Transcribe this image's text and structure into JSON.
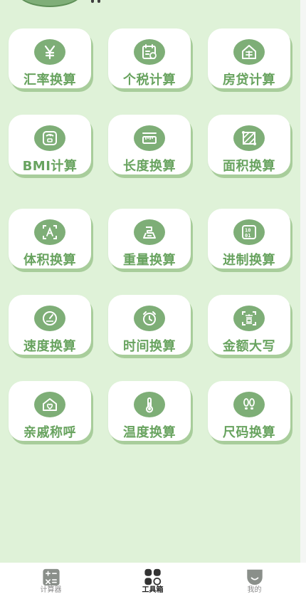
{
  "colors": {
    "background": "#dff2d8",
    "card": "#ffffff",
    "accent": "#7eae77",
    "label": "#68a35f",
    "card_shadow": "#a8cd9b"
  },
  "tools": [
    {
      "label": "汇率换算",
      "icon": "yen-icon"
    },
    {
      "label": "个税计算",
      "icon": "tax-calendar-icon"
    },
    {
      "label": "房贷计算",
      "icon": "house-loan-icon"
    },
    {
      "label": "BMI计算",
      "icon": "scale-icon"
    },
    {
      "label": "长度换算",
      "icon": "ruler-icon"
    },
    {
      "label": "面积换算",
      "icon": "area-icon"
    },
    {
      "label": "体积换算",
      "icon": "cube-icon"
    },
    {
      "label": "重量换算",
      "icon": "weight-icon"
    },
    {
      "label": "进制换算",
      "icon": "binary-icon"
    },
    {
      "label": "速度换算",
      "icon": "speedometer-icon"
    },
    {
      "label": "时间换算",
      "icon": "alarm-clock-icon"
    },
    {
      "label": "金额大写",
      "icon": "chinese-numeral-icon"
    },
    {
      "label": "亲戚称呼",
      "icon": "family-home-icon"
    },
    {
      "label": "温度换算",
      "icon": "thermometer-icon"
    },
    {
      "label": "尺码换算",
      "icon": "footprints-icon"
    }
  ],
  "tabbar": {
    "tabs": [
      {
        "label": "计算器",
        "icon": "calculator-icon",
        "active": false
      },
      {
        "label": "工具箱",
        "icon": "grid-tools-icon",
        "active": true
      },
      {
        "label": "我的",
        "icon": "profile-icon",
        "active": false
      }
    ]
  }
}
